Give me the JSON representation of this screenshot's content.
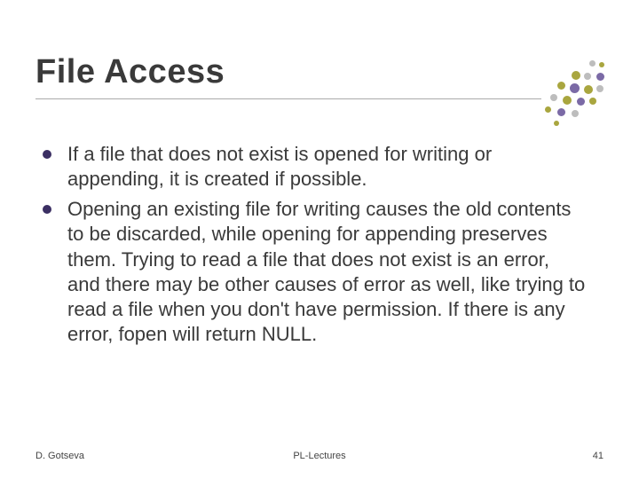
{
  "slide": {
    "title": "File Access",
    "bullets": [
      "If a file that does not exist is opened for writing or appending, it is created if possible.",
      "Opening an existing file for writing causes the old contents to be discarded, while opening for appending preserves them. Trying to read a file that does not exist is an error, and there may be other causes of error as well, like trying to read a file when you don't have permission. If there is any error, fopen will return NULL."
    ],
    "footer": {
      "left": "D. Gotseva",
      "center": "PL-Lectures",
      "right": "41"
    },
    "decorative_colors": {
      "olive": "#a9a63f",
      "purple": "#7b6aa6",
      "grey": "#bdbdbd"
    }
  }
}
